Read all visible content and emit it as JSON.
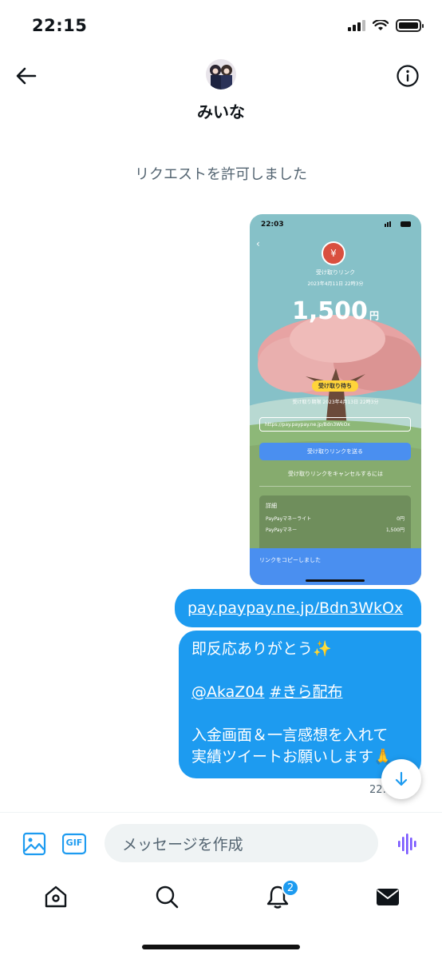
{
  "status_bar": {
    "time": "22:15"
  },
  "header": {
    "name": "みいな"
  },
  "system_message": "リクエストを許可しました",
  "image_message": {
    "status_time": "22:03",
    "title": "受け取りリンク",
    "date": "2023年4月11日 22時3分",
    "amount": "1,500",
    "amount_unit": "円",
    "badge": "受け取り待ち",
    "expiry": "受け取り期限 2023年4月13日 22時3分",
    "url": "https://pay.paypay.ne.jp/Bdn3WkOx",
    "send_button": "受け取りリンクを送る",
    "cancel_link": "受け取りリンクをキャンセルするには",
    "detail_heading": "詳細",
    "detail_rows": [
      {
        "label": "PayPayマネーライト",
        "value": "0円"
      },
      {
        "label": "PayPayマネー",
        "value": "1,500円"
      }
    ],
    "toast": "リンクをコピーしました"
  },
  "messages": {
    "link": "pay.paypay.ne.jp/Bdn3WkOx",
    "main": {
      "line1": "即反応ありがとう✨",
      "mention": "@AkaZ04",
      "hashtag": "#きら配布",
      "line3": "入金画面＆一言感想を入れて",
      "line4": "実績ツイートお願いします🙏"
    },
    "time": "22:15"
  },
  "composer": {
    "placeholder": "メッセージを作成",
    "gif_label": "GIF"
  },
  "tabbar": {
    "notification_count": "2"
  },
  "colors": {
    "accent": "#1d9bf0",
    "voice": "#7856ff"
  }
}
